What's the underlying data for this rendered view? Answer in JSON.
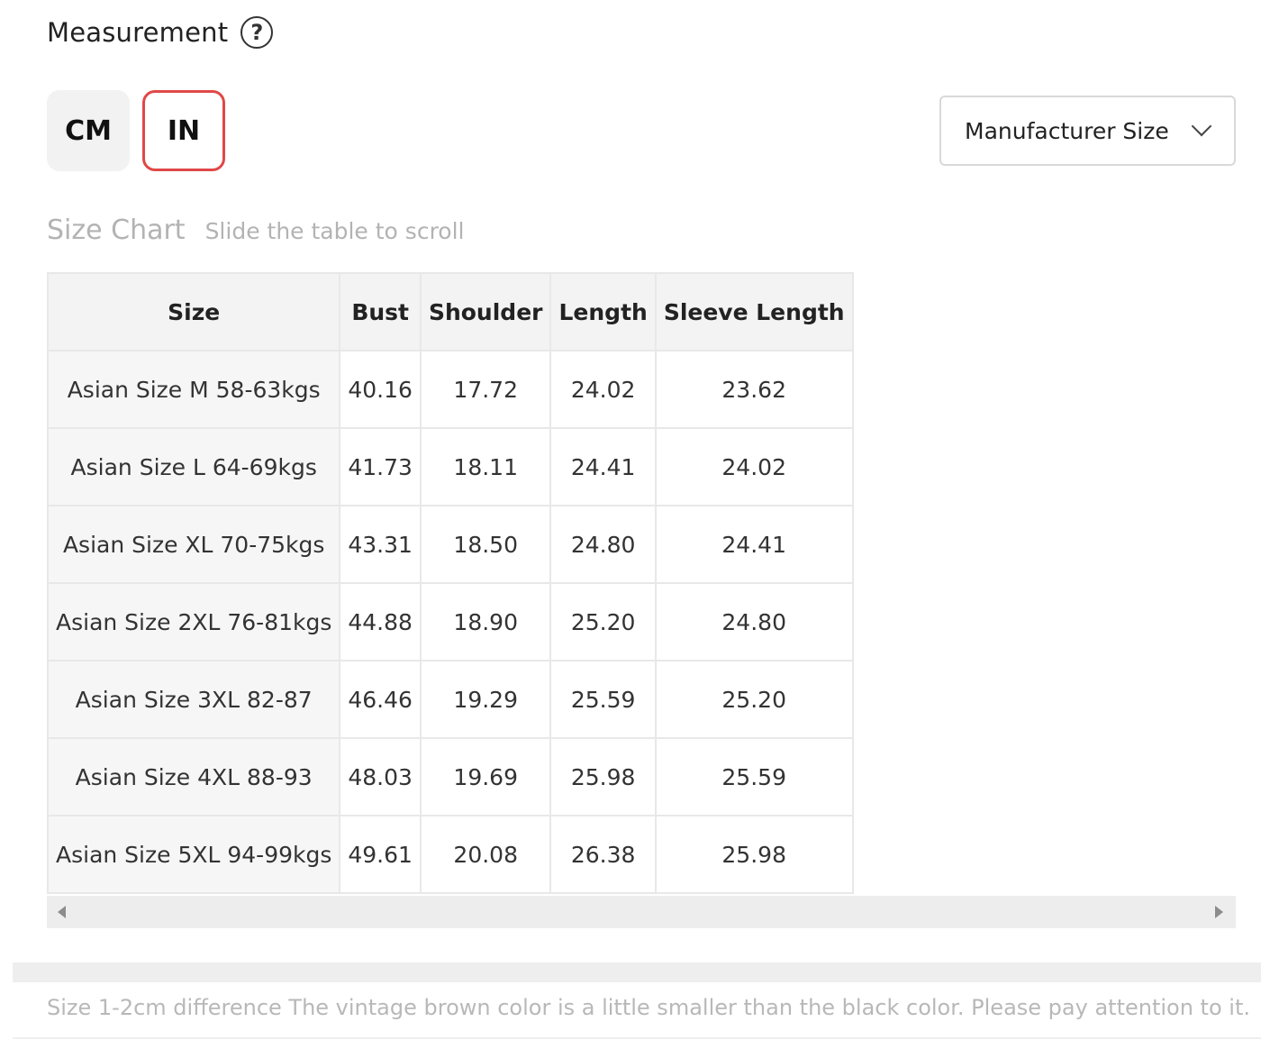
{
  "header": {
    "title": "Measurement",
    "help_icon": "question-circle-icon"
  },
  "units": {
    "cm_label": "CM",
    "in_label": "IN",
    "selected": "IN",
    "accent": "#e04848"
  },
  "size_select": {
    "value": "Manufacturer Size",
    "icon": "chevron-down-icon"
  },
  "chart": {
    "title": "Size Chart",
    "hint": "Slide the table to scroll"
  },
  "table": {
    "headers": [
      "Size",
      "Bust",
      "Shoulder",
      "Length",
      "Sleeve Length"
    ],
    "rows": [
      [
        "Asian Size M 58-63kgs",
        "40.16",
        "17.72",
        "24.02",
        "23.62"
      ],
      [
        "Asian Size L 64-69kgs",
        "41.73",
        "18.11",
        "24.41",
        "24.02"
      ],
      [
        "Asian Size XL 70-75kgs",
        "43.31",
        "18.50",
        "24.80",
        "24.41"
      ],
      [
        "Asian Size 2XL 76-81kgs",
        "44.88",
        "18.90",
        "25.20",
        "24.80"
      ],
      [
        "Asian Size 3XL 82-87",
        "46.46",
        "19.29",
        "25.59",
        "25.20"
      ],
      [
        "Asian Size 4XL 88-93",
        "48.03",
        "19.69",
        "25.98",
        "25.59"
      ],
      [
        "Asian Size 5XL 94-99kgs",
        "49.61",
        "20.08",
        "26.38",
        "25.98"
      ]
    ]
  },
  "note": "Size 1-2cm difference The vintage brown color is a little smaller than the black color. Please pay attention to it."
}
